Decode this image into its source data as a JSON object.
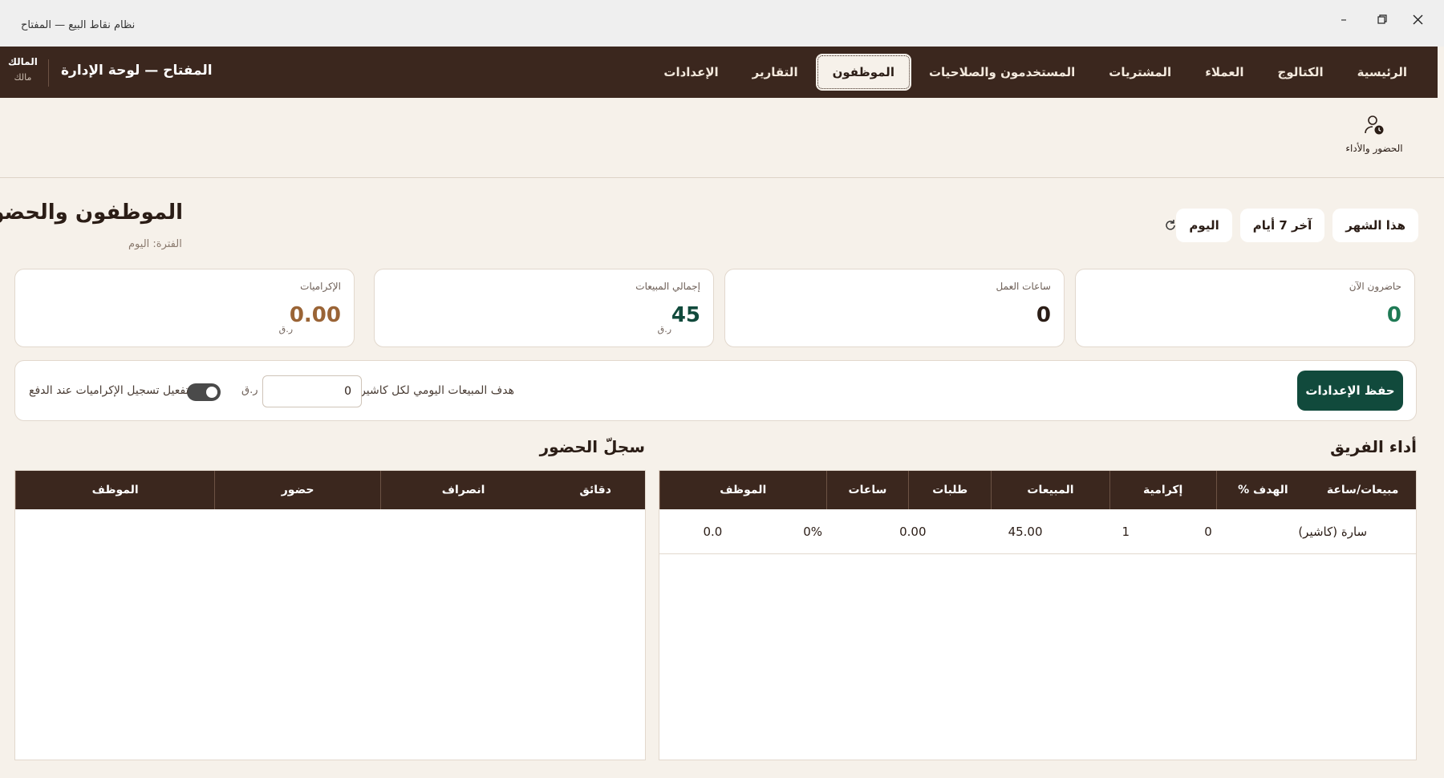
{
  "window": {
    "title": "نظام نقاط البيع — المفتاح"
  },
  "nav": {
    "tabs": [
      {
        "label": "الرئيسية"
      },
      {
        "label": "الكتالوج"
      },
      {
        "label": "العملاء"
      },
      {
        "label": "المشتريات"
      },
      {
        "label": "المستخدمون والصلاحيات"
      },
      {
        "label": "الموظفون"
      },
      {
        "label": "التقارير"
      },
      {
        "label": "الإعدادات"
      }
    ],
    "active_tab": "الموظفون",
    "brand": "المفتاح — لوحة الإدارة",
    "user_name": "المالك",
    "user_role": "مالك"
  },
  "subnav": {
    "item_label": "الحضور والأداء",
    "item_icon": "user-clock-icon"
  },
  "page": {
    "title": "الموظفون والحضور",
    "period": "الفترة: اليوم",
    "period_buttons": [
      "اليوم",
      "آخر 7 أيام",
      "هذا الشهر"
    ]
  },
  "stats": {
    "present_now": {
      "label": "حاضرون الآن",
      "value": "0",
      "color": "#1f7a55"
    },
    "work_hours": {
      "label": "ساعات العمل",
      "value": "0",
      "color": "#2b1d16"
    },
    "total_sales": {
      "label": "إجمالي المبيعات",
      "value": "45",
      "unit": "ر.ق",
      "color": "#114a3c"
    },
    "tips": {
      "label": "الإكراميات",
      "value": "0.00",
      "unit": "ر.ق",
      "color": "#9a6436"
    }
  },
  "settings": {
    "save_label": "حفظ الإعدادات",
    "goal_label": "هدف المبيعات اليومي لكل كاشير",
    "goal_value": "0",
    "goal_unit": "ر.ق",
    "tips_toggle_label": "تفعيل تسجيل الإكراميات عند الدفع",
    "tips_toggle_on": true
  },
  "team": {
    "title": "أداء الفريق",
    "headers": [
      "الموظف",
      "ساعات",
      "طلبات",
      "المبيعات",
      "إكرامية",
      "الهدف %",
      "مبيعات/ساعة"
    ],
    "rows": [
      [
        "سارة (كاشير)",
        "0",
        "1",
        "45.00",
        "0.00",
        "0%",
        "0.0"
      ]
    ]
  },
  "attendance": {
    "title": "سجلّ الحضور",
    "headers": [
      "الموظف",
      "حضور",
      "انصراف",
      "دقائق"
    ],
    "rows": []
  },
  "colors": {
    "header_bg": "#3b271e",
    "accent_green": "#114a3c",
    "page_bg": "#f6f1ea"
  }
}
